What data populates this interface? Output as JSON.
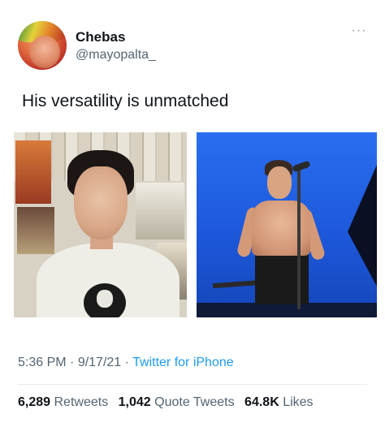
{
  "author": {
    "name": "Chebas",
    "handle": "@mayopalta_"
  },
  "more_glyph": "···",
  "tweet": {
    "text": "His versatility is unmatched"
  },
  "meta": {
    "time": "5:36 PM",
    "sep1": " · ",
    "date": "9/17/21",
    "sep2": " · ",
    "source": "Twitter for iPhone"
  },
  "stats": {
    "retweets_count": "6,289",
    "retweets_label": "Retweets",
    "quotes_count": "1,042",
    "quotes_label": "Quote Tweets",
    "likes_count": "64.8K",
    "likes_label": "Likes"
  },
  "colors": {
    "link": "#1d9bf0",
    "secondary_text": "#536471",
    "primary_text": "#0f1419"
  }
}
